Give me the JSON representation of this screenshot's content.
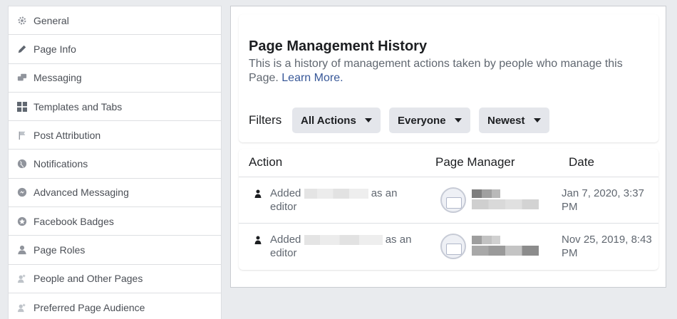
{
  "sidebar": {
    "items": [
      {
        "label": "General",
        "icon": "gear-icon"
      },
      {
        "label": "Page Info",
        "icon": "pencil-icon"
      },
      {
        "label": "Messaging",
        "icon": "chat-icon"
      },
      {
        "label": "Templates and Tabs",
        "icon": "grid-icon"
      },
      {
        "label": "Post Attribution",
        "icon": "flag-icon"
      },
      {
        "label": "Notifications",
        "icon": "globe-icon"
      },
      {
        "label": "Advanced Messaging",
        "icon": "messenger-icon"
      },
      {
        "label": "Facebook Badges",
        "icon": "badge-icon"
      },
      {
        "label": "Page Roles",
        "icon": "person-icon"
      },
      {
        "label": "People and Other Pages",
        "icon": "people-icon"
      },
      {
        "label": "Preferred Page Audience",
        "icon": "people-icon"
      }
    ]
  },
  "history": {
    "title": "Page Management History",
    "description": "This is a history of management actions taken by people who manage this Page.",
    "learn_more": "Learn More.",
    "filters_label": "Filters",
    "filters": [
      "All Actions",
      "Everyone",
      "Newest"
    ]
  },
  "table": {
    "columns": [
      "Action",
      "Page Manager",
      "Date"
    ],
    "rows": [
      {
        "action_prefix": "Added",
        "action_suffix": "as an editor",
        "date": "Jan 7, 2020, 3:37 PM"
      },
      {
        "action_prefix": "Added",
        "action_suffix": "as an editor",
        "date": "Nov 25, 2019, 8:43 PM"
      }
    ]
  }
}
